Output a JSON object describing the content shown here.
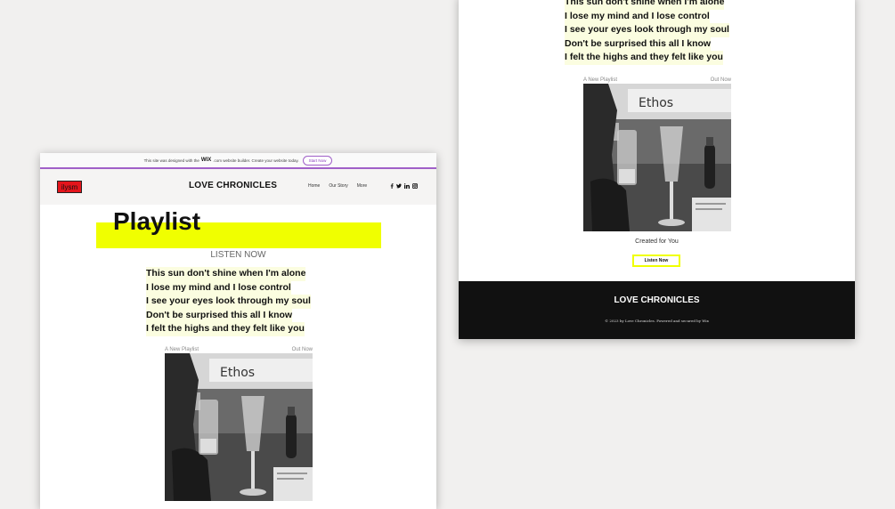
{
  "wix_banner": {
    "text_before": "This site was designed with the",
    "wix_logo": "WIX",
    "text_after": ".com website builder. Create your website today.",
    "cta": "Start Now"
  },
  "header": {
    "logo": "ilysm",
    "site_name": "LOVE CHRONICLES",
    "nav": [
      "Home",
      "Our Story",
      "More"
    ],
    "social_icons": [
      "facebook-icon",
      "twitter-icon",
      "linkedin-icon",
      "instagram-icon"
    ]
  },
  "hero": {
    "title": "Playlist",
    "subtitle": "LISTEN NOW"
  },
  "lyrics": [
    "This sun don't shine when I'm alone",
    "I lose my mind and I lose control",
    "I see your eyes look through my soul",
    "Don't be surprised this all I know",
    "I felt the highs and they felt like you"
  ],
  "album": {
    "label_left": "A New Playlist",
    "label_right": "Out Now",
    "sign_text": "Ethos",
    "caption": "Created for You",
    "button": "Listen Now"
  },
  "footer": {
    "title": "LOVE CHRONICLES",
    "copyright": "© 2023 by Love Chronicles. Powered and secured by Wix"
  },
  "colors": {
    "accent_yellow": "#f0ff00",
    "logo_red": "#e4151c",
    "wix_purple": "#a060c8",
    "footer_bg": "#111111"
  }
}
